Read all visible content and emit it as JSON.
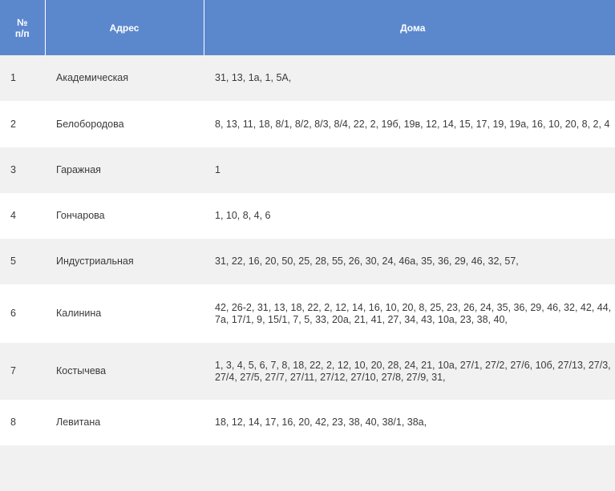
{
  "table": {
    "headers": {
      "num_line1": "№",
      "num_line2": "п/п",
      "address": "Адрес",
      "houses": "Дома"
    },
    "rows": [
      {
        "num": "1",
        "street": "Академическая",
        "houses": "31, 13, 1а, 1, 5А,"
      },
      {
        "num": "2",
        "street": "Белобородова",
        "houses": "8, 13, 11, 18, 8/1, 8/2, 8/3, 8/4, 22, 2, 19б, 19в, 12, 14, 15, 17, 19, 19а, 16, 10, 20, 8, 2, 4"
      },
      {
        "num": "3",
        "street": "Гаражная",
        "houses": "1"
      },
      {
        "num": "4",
        "street": "Гончарова",
        "houses": "1, 10, 8, 4, 6"
      },
      {
        "num": "5",
        "street": "Индустриальная",
        "houses": "31, 22, 16, 20, 50, 25, 28, 55, 26, 30, 24, 46а, 35, 36, 29, 46, 32, 57,"
      },
      {
        "num": "6",
        "street": "Калинина",
        "houses": "42, 26-2, 31, 13, 18, 22, 2, 12, 14, 16, 10, 20, 8, 25, 23, 26, 24, 35, 36, 29, 46, 32, 42, 44, 7а, 17/1, 9, 15/1, 7, 5, 33, 20а, 21, 41, 27, 34, 43, 10а, 23, 38, 40,"
      },
      {
        "num": "7",
        "street": "Костычева",
        "houses": "1, 3, 4, 5, 6, 7, 8, 18, 22, 2, 12, 10, 20, 28, 24, 21, 10а, 27/1, 27/2, 27/6, 10б, 27/13, 27/3, 27/4, 27/5, 27/7, 27/11, 27/12, 27/10, 27/8, 27/9, 31,"
      },
      {
        "num": "8",
        "street": "Левитана",
        "houses": "18, 12, 14, 17, 16, 20, 42, 23, 38, 40, 38/1, 38а,"
      },
      {
        "num": "",
        "street": "",
        "houses": ""
      }
    ]
  }
}
